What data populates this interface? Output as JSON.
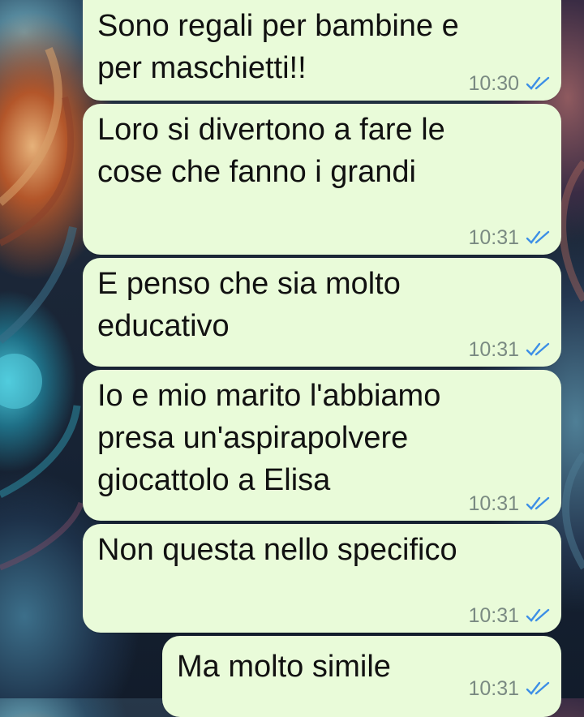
{
  "messages": [
    {
      "text": "Sono regali per bambine e per maschietti!!",
      "time": "10:30",
      "status": "read"
    },
    {
      "text": "Loro si divertono a fare le cose che fanno i grandi",
      "time": "10:31",
      "status": "read"
    },
    {
      "text": "E penso che sia molto educativo",
      "time": "10:31",
      "status": "read"
    },
    {
      "text": "Io e mio marito l'abbiamo presa un'aspirapolvere giocattolo a Elisa",
      "time": "10:31",
      "status": "read"
    },
    {
      "text": "Non questa nello specifico",
      "time": "10:31",
      "status": "read"
    },
    {
      "text": "Ma molto simile",
      "time": "10:31",
      "status": "read"
    }
  ],
  "colors": {
    "bubble": "#e9fbd9",
    "tick": "#3d8fe6",
    "time": "#7a8a82"
  },
  "icons": {
    "read_receipt": "double-check-icon"
  }
}
